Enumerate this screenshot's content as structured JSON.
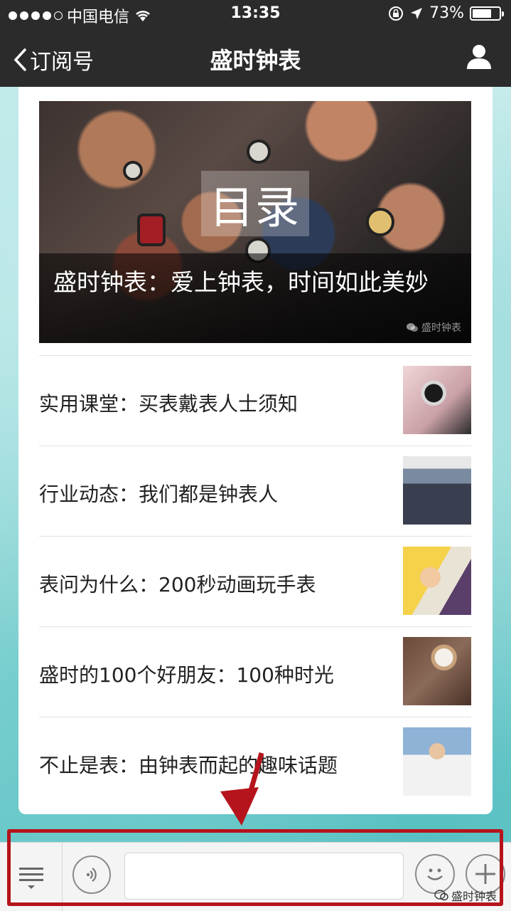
{
  "status_bar": {
    "carrier": "中国电信",
    "time": "13:35",
    "battery": "73%",
    "battery_level": 0.73
  },
  "nav": {
    "back_label": "订阅号",
    "title": "盛时钟表"
  },
  "hero": {
    "badge": "目录",
    "caption": "盛时钟表：爱上钟表，时间如此美妙",
    "watermark": "盛时钟表"
  },
  "articles": [
    {
      "title": "实用课堂：买表戴表人士须知"
    },
    {
      "title": "行业动态：我们都是钟表人"
    },
    {
      "title": "表问为什么：200秒动画玩手表"
    },
    {
      "title": "盛时的100个好朋友：100种时光"
    },
    {
      "title": "不止是表：由钟表而起的趣味话题"
    }
  ],
  "bottom_bar": {
    "watermark": "盛时钟表"
  },
  "colors": {
    "nav_bg": "#2b2b2b",
    "annotation": "#b5141c"
  }
}
